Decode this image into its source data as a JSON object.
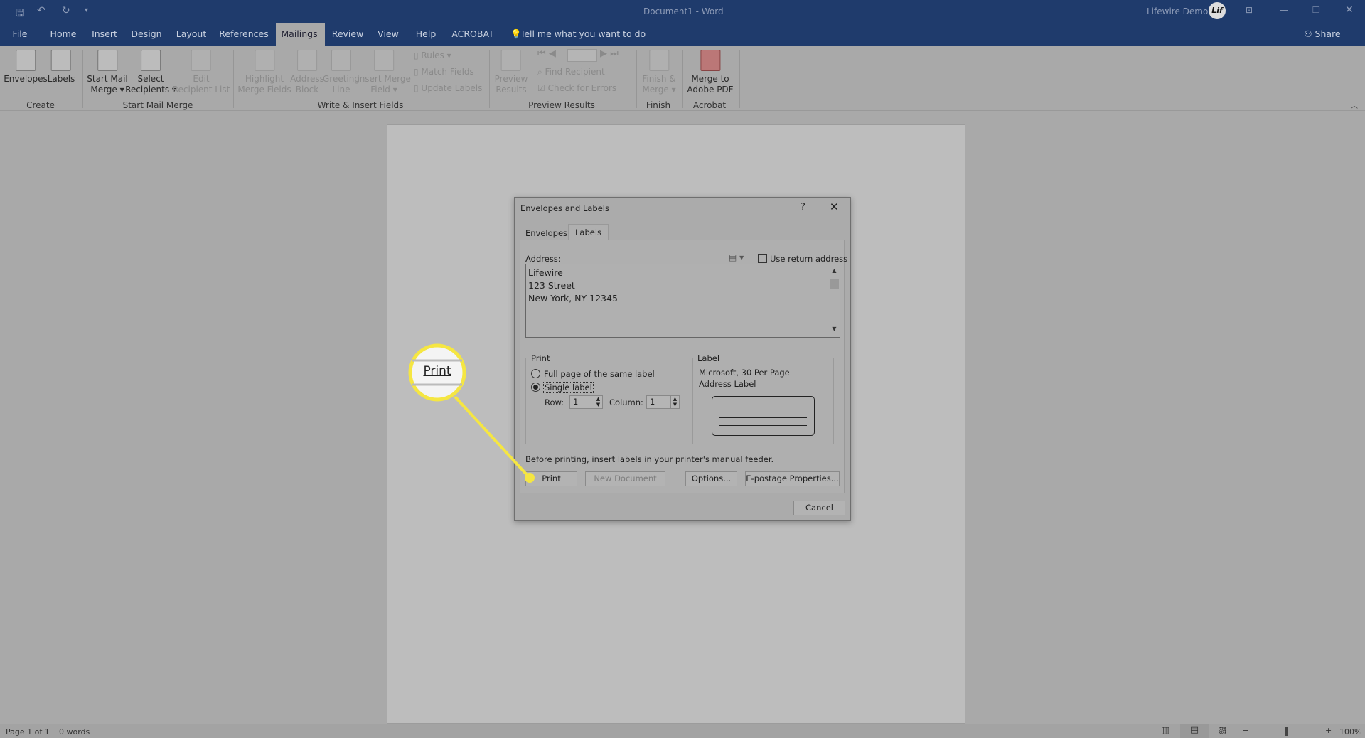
{
  "window": {
    "title": "Document1 - Word",
    "user": "Lifewire Demo",
    "avatar_text": "Lif",
    "share": "Share"
  },
  "tabs": [
    "File",
    "Home",
    "Insert",
    "Design",
    "Layout",
    "References",
    "Mailings",
    "Review",
    "View",
    "Help",
    "ACROBAT"
  ],
  "active_tab": "Mailings",
  "tell_me": "Tell me what you want to do",
  "ribbon": {
    "items": [
      {
        "l1": "Envelopes",
        "l2": ""
      },
      {
        "l1": "Labels",
        "l2": ""
      },
      {
        "l1": "Start Mail",
        "l2": "Merge ▾"
      },
      {
        "l1": "Select",
        "l2": "Recipients ▾"
      },
      {
        "l1": "Edit",
        "l2": "Recipient List"
      },
      {
        "l1": "Highlight",
        "l2": "Merge Fields"
      },
      {
        "l1": "Address",
        "l2": "Block"
      },
      {
        "l1": "Greeting",
        "l2": "Line"
      },
      {
        "l1": "Insert Merge",
        "l2": "Field ▾"
      },
      {
        "l1": "Preview",
        "l2": "Results"
      },
      {
        "l1": "Finish &",
        "l2": "Merge ▾"
      },
      {
        "l1": "Merge to",
        "l2": "Adobe PDF"
      }
    ],
    "small": [
      "Rules ▾",
      "Match Fields",
      "Update Labels",
      "Find Recipient",
      "Check for Errors"
    ],
    "groups": [
      "Create",
      "Start Mail Merge",
      "Write & Insert Fields",
      "Preview Results",
      "Finish",
      "Acrobat"
    ]
  },
  "dialog": {
    "title": "Envelopes and Labels",
    "help": "?",
    "tabs": [
      "Envelopes",
      "Labels"
    ],
    "active_tab": "Labels",
    "address_label": "Address:",
    "use_return": "Use return address",
    "use_return_checked": false,
    "address_lines": [
      "Lifewire",
      "123 Street",
      "New York, NY 12345"
    ],
    "print_group": "Print",
    "full_page": "Full page of the same label",
    "single_label": "Single label",
    "selected": "Single label",
    "row_label": "Row:",
    "row_value": "1",
    "column_label": "Column:",
    "column_value": "1",
    "label_group": "Label",
    "label_line1": "Microsoft, 30 Per Page",
    "label_line2": "Address Label",
    "note": "Before printing, insert labels in your printer's manual feeder.",
    "buttons": {
      "print": "Print",
      "new_document": "New Document",
      "options": "Options...",
      "epostage": "E-postage Properties...",
      "cancel": "Cancel"
    }
  },
  "callout": {
    "text": "Print",
    "color": "#f5e642"
  },
  "status": {
    "page": "Page 1 of 1",
    "words": "0 words",
    "zoom": "100%",
    "zoom_level_percent": 100
  }
}
